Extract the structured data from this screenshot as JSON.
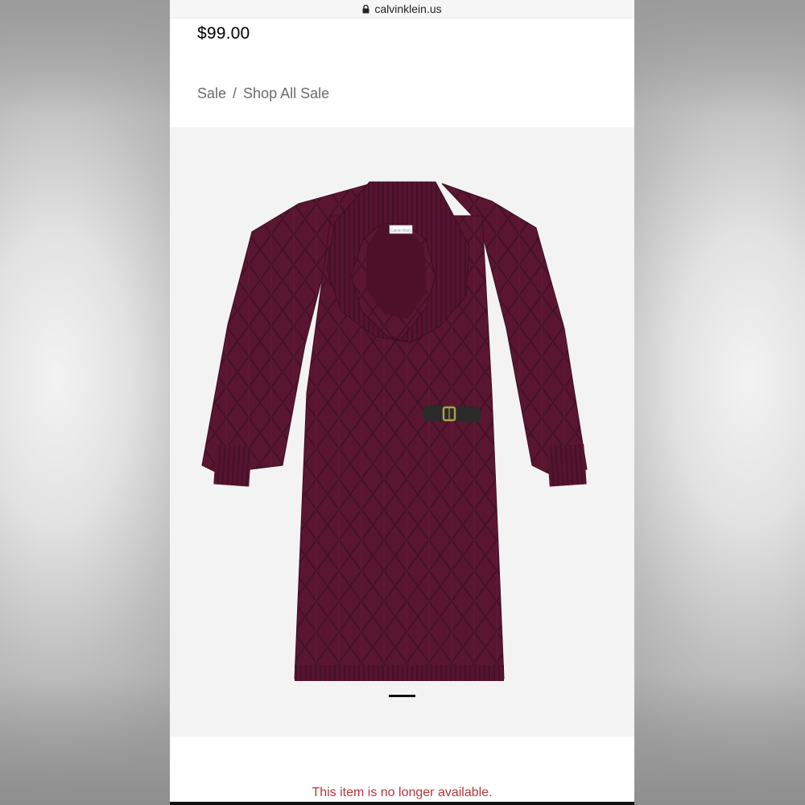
{
  "browser": {
    "url": "calvinklein.us",
    "lock_icon": "lock-icon"
  },
  "product": {
    "price": "$99.00",
    "color_hex": "#5a1630"
  },
  "breadcrumb": {
    "items": [
      "Sale",
      "Shop All Sale"
    ],
    "separator": "/"
  },
  "gallery": {
    "label_text": "Calvin Klein",
    "active_slide": 1
  },
  "status": {
    "message": "This item is no longer available.",
    "color": "#b5343a"
  }
}
